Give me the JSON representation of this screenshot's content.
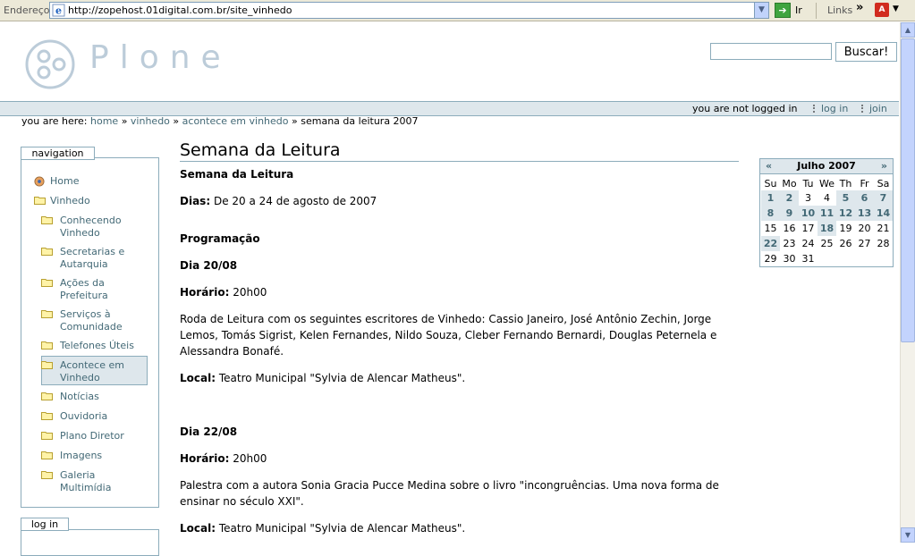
{
  "browser": {
    "address_label": "Endereço",
    "url": "http://zopehost.01digital.com.br/site_vinhedo",
    "go_label": "Ir",
    "links_label": "Links",
    "links_more": "»"
  },
  "header": {
    "logo_text": "Plone",
    "search_placeholder": "",
    "search_button": "Buscar!"
  },
  "personal_bar": {
    "status": "you are not logged in",
    "login_link": "log in",
    "join_link": "join"
  },
  "breadcrumb": {
    "prefix": "you are here:",
    "items": [
      "home",
      "vinhedo",
      "acontece em vinhedo"
    ],
    "separator": "»",
    "current": "semana da leitura 2007"
  },
  "navigation": {
    "header": "navigation",
    "items": [
      {
        "label": "Home"
      },
      {
        "label": "Vinhedo"
      },
      {
        "label": "Conhecendo Vinhedo"
      },
      {
        "label": "Secretarias e Autarquia"
      },
      {
        "label": "Ações da Prefeitura"
      },
      {
        "label": "Serviços à Comunidade"
      },
      {
        "label": "Telefones Úteis"
      },
      {
        "label": "Acontece em Vinhedo"
      },
      {
        "label": "Notícias"
      },
      {
        "label": "Ouvidoria"
      },
      {
        "label": "Plano Diretor"
      },
      {
        "label": "Imagens"
      },
      {
        "label": "Galeria Multimídia"
      }
    ]
  },
  "login_portlet": {
    "header": "log in"
  },
  "content": {
    "title": "Semana da Leitura",
    "subtitle": "Semana da Leitura",
    "dias_label": "Dias:",
    "dias_value": "De 20 a 24 de agosto de 2007",
    "programacao": "Programação",
    "day1": "Dia 20/08",
    "horario_label": "Horário:",
    "day1_time": "20h00",
    "day1_desc": "Roda de Leitura com os seguintes escritores de Vinhedo: Cassio Janeiro, José Antônio Zechin, Jorge Lemos, Tomás Sigrist, Kelen Fernandes, Nildo Souza, Cleber Fernando Bernardi, Douglas Peternela e Alessandra Bonafé.",
    "local_label": "Local:",
    "day1_local": "Teatro Municipal \"Sylvia de Alencar Matheus\".",
    "day2": "Dia 22/08",
    "day2_time": "20h00",
    "day2_desc": "Palestra com a autora Sonia Gracia Pucce Medina sobre o livro \"incongruências. Uma nova forma de ensinar no século XXI\".",
    "day2_local": "Teatro Municipal \"Sylvia de Alencar Matheus\"."
  },
  "calendar": {
    "prev": "«",
    "next": "»",
    "month": "Julho 2007",
    "weekdays": [
      "Su",
      "Mo",
      "Tu",
      "We",
      "Th",
      "Fr",
      "Sa"
    ],
    "weeks": [
      [
        "1",
        "2",
        "3",
        "4",
        "5",
        "6",
        "7"
      ],
      [
        "8",
        "9",
        "10",
        "11",
        "12",
        "13",
        "14"
      ],
      [
        "15",
        "16",
        "17",
        "18",
        "19",
        "20",
        "21"
      ],
      [
        "22",
        "23",
        "24",
        "25",
        "26",
        "27",
        "28"
      ],
      [
        "29",
        "30",
        "31",
        "",
        "",
        "",
        ""
      ]
    ],
    "event_days": [
      "1",
      "2",
      "5",
      "6",
      "7",
      "8",
      "9",
      "10",
      "11",
      "12",
      "13",
      "14",
      "18",
      "22"
    ]
  },
  "colors": {
    "accent": "#436976",
    "border": "#8cacbb",
    "highlight": "#dee7ec"
  }
}
